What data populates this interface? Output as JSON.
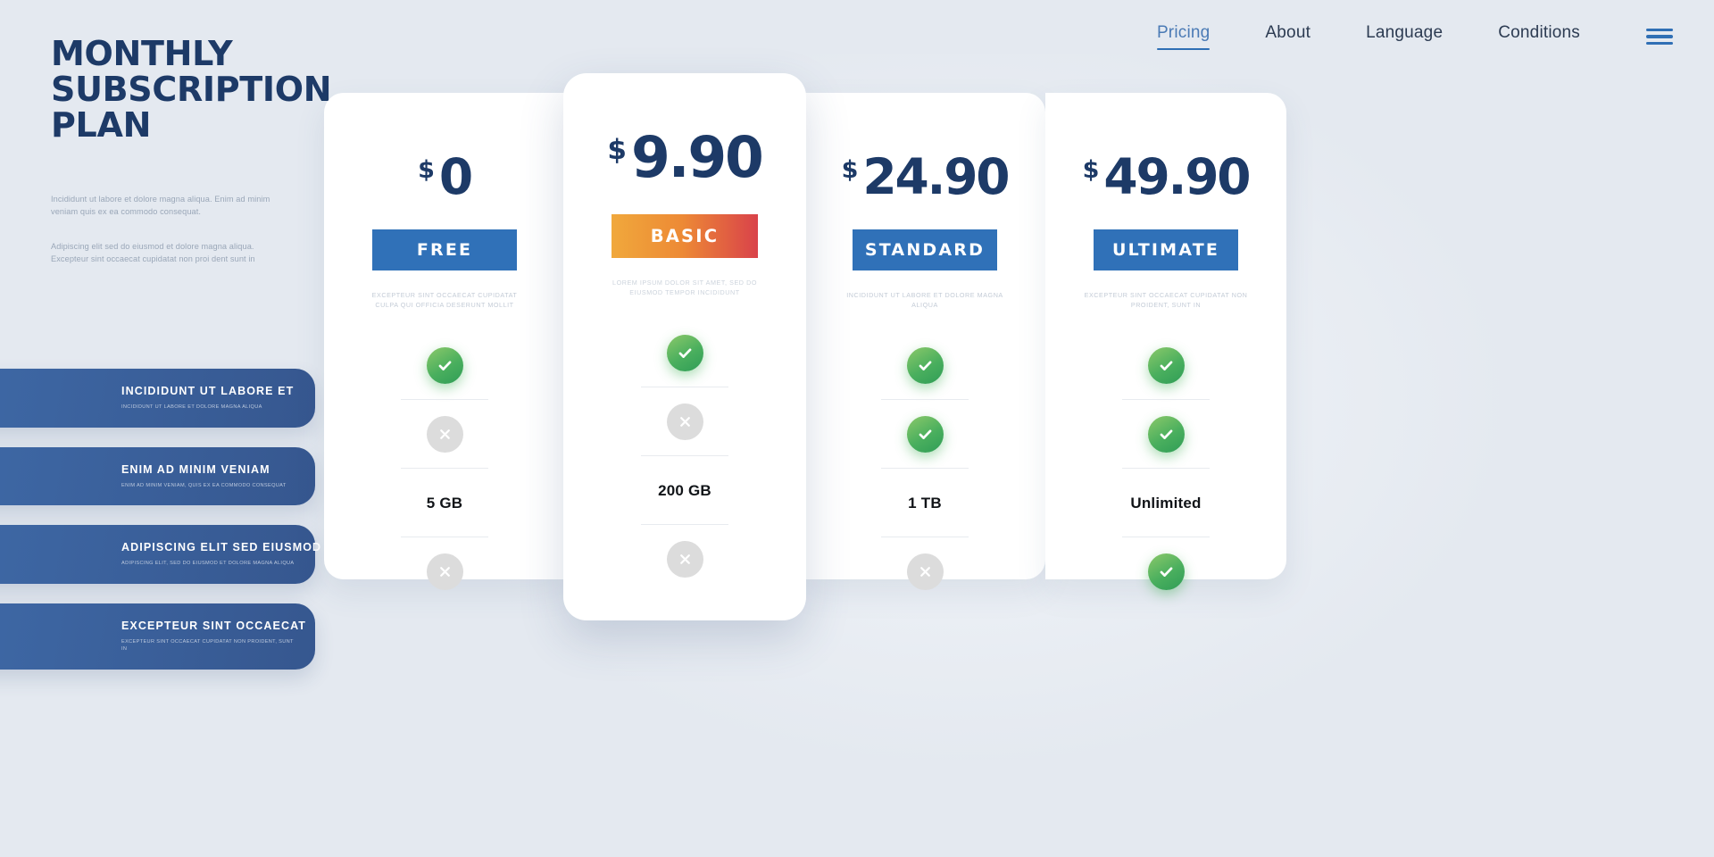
{
  "nav": {
    "items": [
      {
        "label": "Pricing",
        "active": true
      },
      {
        "label": "About",
        "active": false
      },
      {
        "label": "Language",
        "active": false
      },
      {
        "label": "Conditions",
        "active": false
      }
    ],
    "menu_icon": "hamburger-menu-icon"
  },
  "hero": {
    "title": "MONTHLY SUBSCRIPTION PLAN",
    "paragraph1": "Incididunt ut labore et dolore magna aliqua. Enim ad minim veniam  quis ex ea commodo consequat.",
    "paragraph2": "Adipiscing elit sed do eiusmod et dolore magna aliqua. Excepteur sint occaecat cupidatat non proi dent sunt in"
  },
  "feature_pills": [
    {
      "title": "INCIDIDUNT UT LABORE ET",
      "subtitle": "INCIDIDUNT UT LABORE ET DOLORE MAGNA ALIQUA"
    },
    {
      "title": "ENIM AD MINIM VENIAM",
      "subtitle": "ENIM AD MINIM VENIAM, QUIS EX EA COMMODO CONSEQUAT"
    },
    {
      "title": "ADIPISCING ELIT SED EIUSMOD",
      "subtitle": "ADIPISCING ELIT, SED DO EIUSMOD ET DOLORE MAGNA ALIQUA"
    },
    {
      "title": "EXCEPTEUR SINT OCCAECAT",
      "subtitle": "EXCEPTEUR SINT OCCAECAT CUPIDATAT NON PROIDENT, SUNT IN"
    }
  ],
  "plans": [
    {
      "currency": "$",
      "price": "0",
      "badge": "FREE",
      "badge_color": "#3071b8",
      "description": "EXCEPTEUR SINT OCCAECAT CUPIDATAT CULPA QUI OFFICIA DESERUNT MOLLIT",
      "features": [
        "check",
        "cross"
      ],
      "storage": "5 GB",
      "last_feature": "cross"
    },
    {
      "currency": "$",
      "price": "9.90",
      "badge": "BASIC",
      "badge_color": "#ed8a35",
      "description": "LOREM IPSUM DOLOR SIT AMET, SED DO EIUSMOD TEMPOR INCIDIDUNT",
      "features": [
        "check",
        "cross"
      ],
      "storage": "200 GB",
      "last_feature": "cross"
    },
    {
      "currency": "$",
      "price": "24.90",
      "badge": "STANDARD",
      "badge_color": "#3071b8",
      "description": "INCIDIDUNT UT LABORE ET DOLORE MAGNA ALIQUA",
      "features": [
        "check",
        "check"
      ],
      "storage": "1 TB",
      "last_feature": "cross"
    },
    {
      "currency": "$",
      "price": "49.90",
      "badge": "ULTIMATE",
      "badge_color": "#3071b8",
      "description": "EXCEPTEUR SINT OCCAECAT CUPIDATAT NON PROIDENT, SUNT IN",
      "features": [
        "check",
        "check"
      ],
      "storage": "Unlimited",
      "last_feature": "check"
    }
  ],
  "colors": {
    "background": "#e4e9f0",
    "brand_navy": "#1d3a67",
    "accent_blue": "#3071b8",
    "accent_orange": "#ed8a35",
    "success_green": "#4aaf5e",
    "disabled_gray": "#dcdcdc"
  }
}
